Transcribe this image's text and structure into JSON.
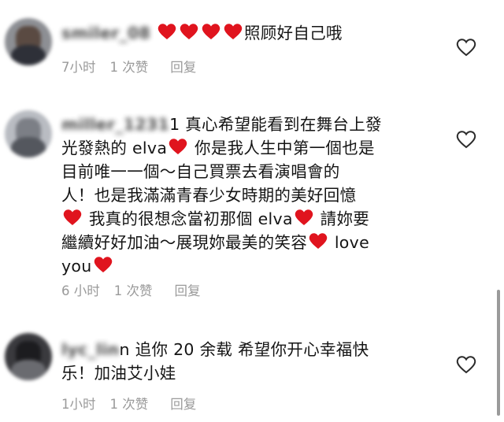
{
  "comments": [
    {
      "username": "smiler_08",
      "pre_text": "",
      "lines": [
        [
          {
            "t": "heart"
          },
          {
            "t": "heart"
          },
          {
            "t": "heart"
          },
          {
            "t": "heart"
          },
          {
            "t": "text",
            "v": "照顾好自己哦"
          }
        ]
      ],
      "time": "7小时",
      "likes": "1 次赞",
      "reply": "回复"
    },
    {
      "username": "miller_1231",
      "lines": [
        [
          {
            "t": "text",
            "v": "1 真心希望能看到在舞台上發"
          }
        ],
        [
          {
            "t": "text",
            "v": "光發熱的 elva"
          },
          {
            "t": "heart"
          },
          {
            "t": "text",
            "v": " 你是我人生中第一個也是"
          }
        ],
        [
          {
            "t": "text",
            "v": "目前唯一一個～自己買票去看演唱會的"
          }
        ],
        [
          {
            "t": "text",
            "v": "人！也是我滿滿青春少女時期的美好回憶"
          }
        ],
        [
          {
            "t": "heart"
          },
          {
            "t": "text",
            "v": " 我真的很想念當初那個 elva"
          },
          {
            "t": "heart"
          },
          {
            "t": "text",
            "v": " 請妳要"
          }
        ],
        [
          {
            "t": "text",
            "v": "繼續好好加油～展現妳最美的笑容"
          },
          {
            "t": "heart"
          },
          {
            "t": "text",
            "v": " love"
          }
        ],
        [
          {
            "t": "text",
            "v": "you"
          },
          {
            "t": "heart"
          }
        ]
      ],
      "time": "6 小时",
      "likes": "1 次赞",
      "reply": "回复"
    },
    {
      "username": "lyc_lin",
      "lines": [
        [
          {
            "t": "text",
            "v": "n 追你 20 余载 希望你开心幸福快"
          }
        ],
        [
          {
            "t": "text",
            "v": "乐！加油艾小娃"
          }
        ]
      ],
      "time": "1小时",
      "likes": "1 次赞",
      "reply": "回复"
    }
  ],
  "icons": {
    "heart": "heart-emoji-icon",
    "like": "heart-outline-icon"
  },
  "colors": {
    "heart": "#e0141e",
    "meta": "#9a9a9a",
    "text": "#151515"
  }
}
